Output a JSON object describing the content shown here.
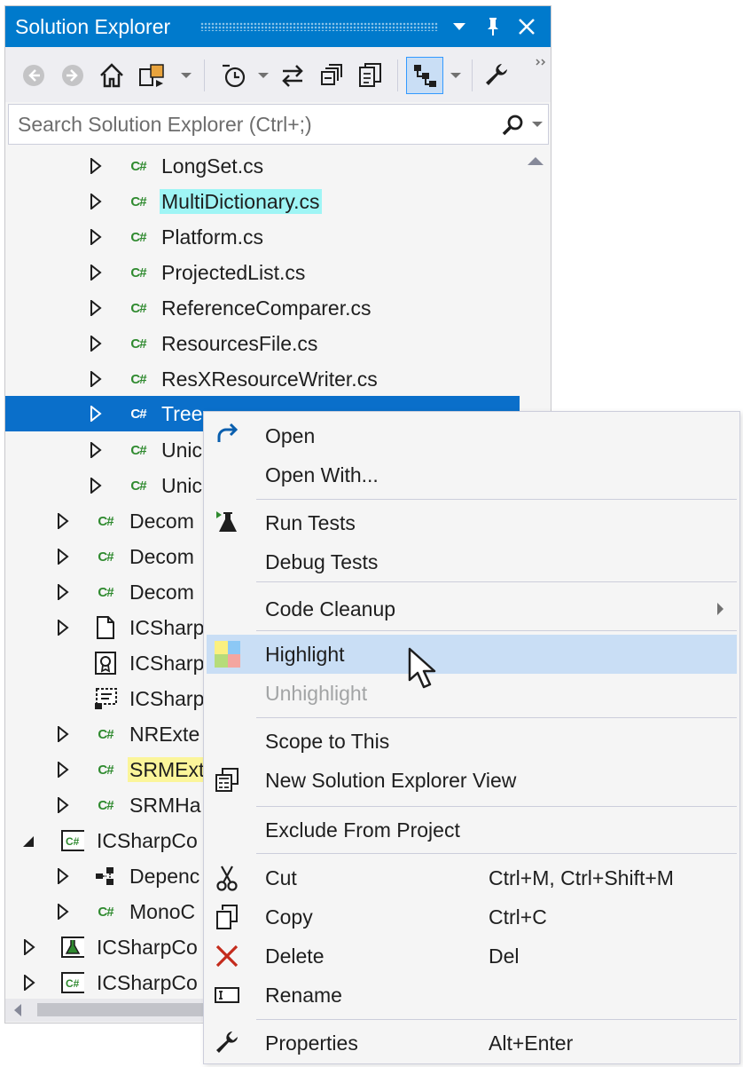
{
  "window": {
    "title": "Solution Explorer"
  },
  "search": {
    "placeholder": "Search Solution Explorer (Ctrl+;)"
  },
  "tree": {
    "items": [
      {
        "label": "LongSet.cs",
        "icon": "csharp-file-icon"
      },
      {
        "label": "MultiDictionary.cs",
        "icon": "csharp-file-icon",
        "highlight": "#9ff5f5"
      },
      {
        "label": "Platform.cs",
        "icon": "csharp-file-icon"
      },
      {
        "label": "ProjectedList.cs",
        "icon": "csharp-file-icon"
      },
      {
        "label": "ReferenceComparer.cs",
        "icon": "csharp-file-icon"
      },
      {
        "label": "ResourcesFile.cs",
        "icon": "csharp-file-icon"
      },
      {
        "label": "ResXResourceWriter.cs",
        "icon": "csharp-file-icon"
      },
      {
        "label": "Tree",
        "icon": "csharp-file-icon",
        "selected": true
      },
      {
        "label": "Unic",
        "icon": "csharp-file-icon"
      },
      {
        "label": "Unic",
        "icon": "csharp-file-icon"
      },
      {
        "label": "Decom",
        "icon": "csharp-file-icon"
      },
      {
        "label": "Decom",
        "icon": "csharp-file-icon"
      },
      {
        "label": "Decom",
        "icon": "csharp-file-icon"
      },
      {
        "label": "ICSharp",
        "icon": "file-icon"
      },
      {
        "label": "ICSharp",
        "icon": "certificate-icon"
      },
      {
        "label": "ICSharp",
        "icon": "config-file-icon"
      },
      {
        "label": "NRExte",
        "icon": "csharp-file-icon"
      },
      {
        "label": "SRMExt",
        "icon": "csharp-file-icon",
        "highlight": "#fbf59a"
      },
      {
        "label": "SRMHa",
        "icon": "csharp-file-icon"
      },
      {
        "label": "ICSharpCo",
        "icon": "csharp-project-icon"
      },
      {
        "label": "Depenc",
        "icon": "dependencies-icon"
      },
      {
        "label": "MonoC",
        "icon": "csharp-file-icon"
      },
      {
        "label": "ICSharpCo",
        "icon": "test-project-icon"
      },
      {
        "label": "ICSharpCo",
        "icon": "csharp-project-icon"
      }
    ]
  },
  "context_menu": {
    "items": [
      {
        "label": "Open",
        "icon": "open-arrow-icon"
      },
      {
        "label": "Open With..."
      },
      {
        "label": "Run Tests",
        "icon": "run-tests-icon"
      },
      {
        "label": "Debug Tests"
      },
      {
        "label": "Code Cleanup"
      },
      {
        "label": "Highlight",
        "icon": "highlight-icon"
      },
      {
        "label": "Unhighlight"
      },
      {
        "label": "Scope to This"
      },
      {
        "label": "New Solution Explorer View",
        "icon": "new-view-icon"
      },
      {
        "label": "Exclude From Project"
      },
      {
        "label": "Cut",
        "shortcut": "Ctrl+M, Ctrl+Shift+M",
        "icon": "scissors-icon"
      },
      {
        "label": "Copy",
        "shortcut": "Ctrl+C",
        "icon": "copy-icon"
      },
      {
        "label": "Delete",
        "shortcut": "Del",
        "icon": "delete-x-icon"
      },
      {
        "label": "Rename",
        "icon": "rename-icon"
      },
      {
        "label": "Properties",
        "shortcut": "Alt+Enter",
        "icon": "wrench-icon"
      }
    ]
  },
  "colors": {
    "accent": "#007acc",
    "selection": "#0a6fca",
    "menu_hover": "#c9def5",
    "csharp_green": "#2f8a2f",
    "delete_red": "#c42b1c"
  }
}
